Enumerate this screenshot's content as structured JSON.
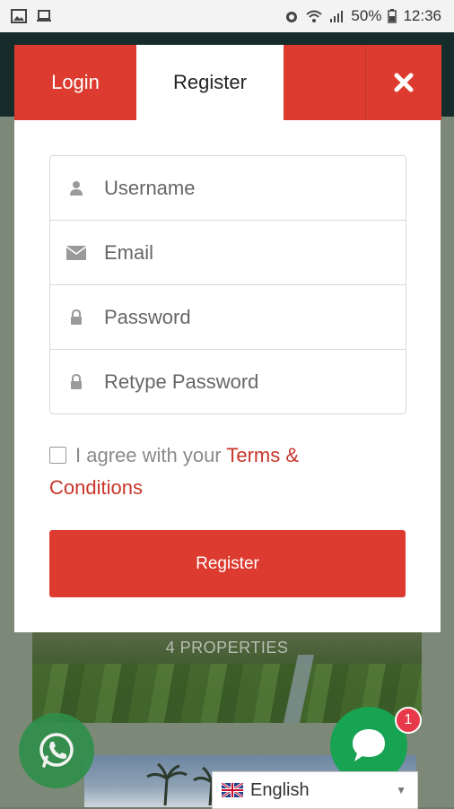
{
  "status_bar": {
    "battery": "50%",
    "time": "12:36",
    "icons": [
      "image-icon",
      "laptop-icon",
      "alarm-icon",
      "wifi-icon",
      "signal-icon",
      "battery-icon"
    ]
  },
  "background": {
    "card_label": "4 PROPERTIES"
  },
  "modal": {
    "tabs": {
      "login": "Login",
      "register": "Register"
    },
    "fields": [
      {
        "placeholder": "Username",
        "icon": "user-icon"
      },
      {
        "placeholder": "Email",
        "icon": "envelope-icon"
      },
      {
        "placeholder": "Password",
        "icon": "lock-icon"
      },
      {
        "placeholder": "Retype Password",
        "icon": "lock-icon"
      }
    ],
    "agree_text": "I agree with your",
    "terms_link": "Terms & Conditions",
    "register_button": "Register"
  },
  "widgets": {
    "chat_badge": "1",
    "language": "English"
  },
  "colors": {
    "accent": "#dd3b2f",
    "link": "#c8352a",
    "chat": "#17a352",
    "whatsapp": "#2f8f4a"
  }
}
